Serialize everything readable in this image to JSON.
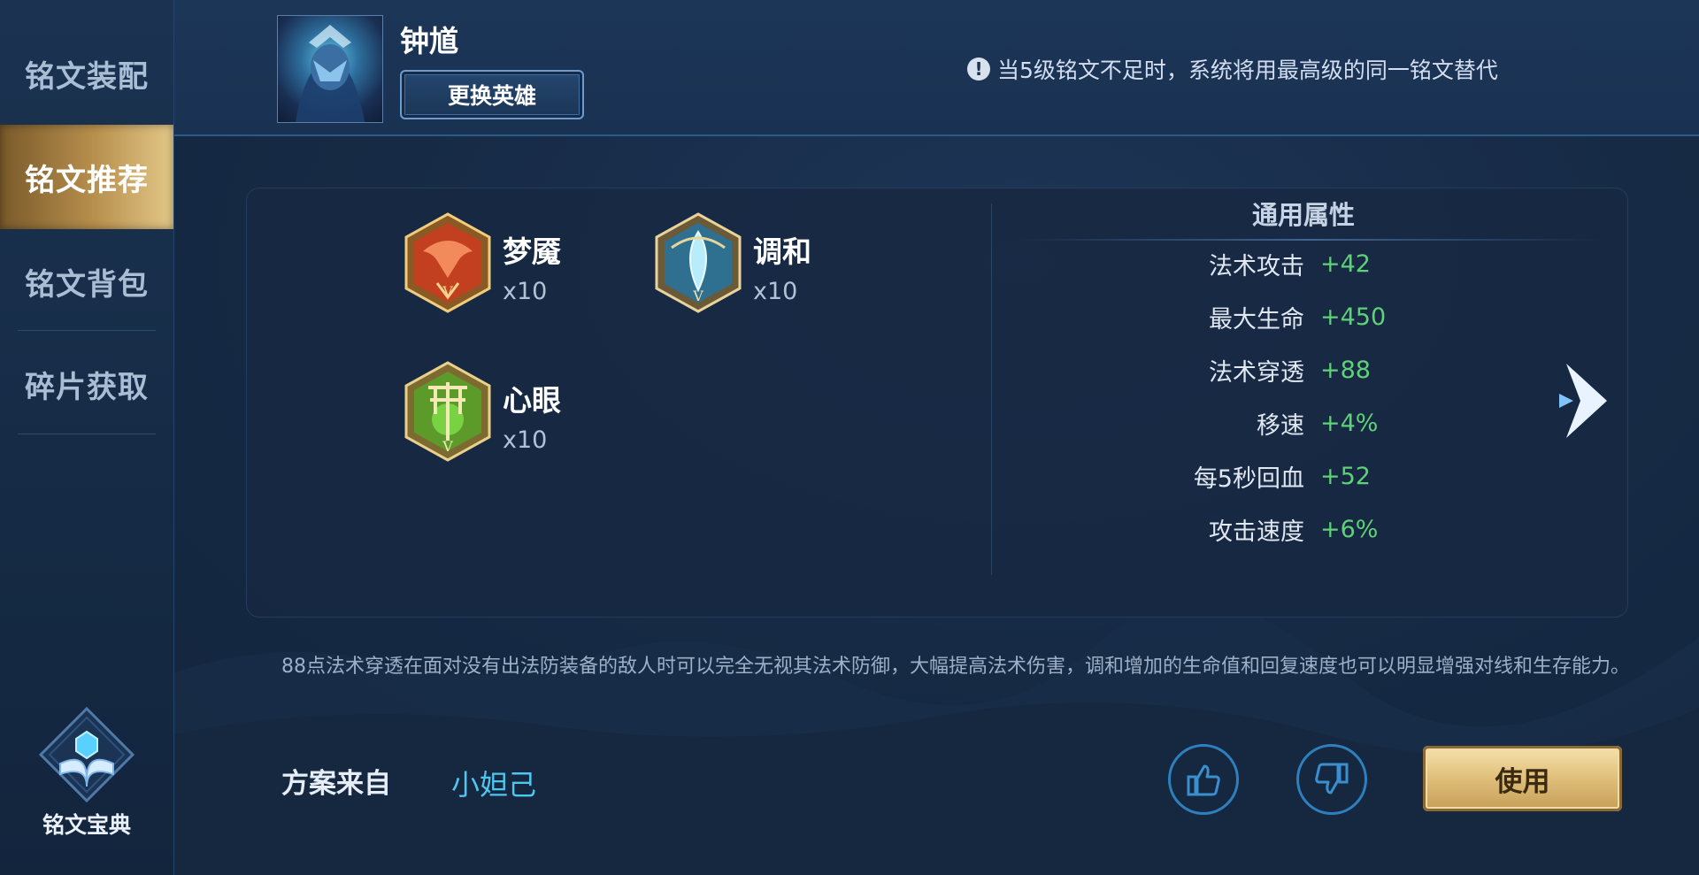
{
  "sidebar": {
    "items": [
      {
        "label": "铭文装配"
      },
      {
        "label": "铭文推荐"
      },
      {
        "label": "铭文背包"
      },
      {
        "label": "碎片获取"
      }
    ],
    "active_index": 1,
    "codex_label": "铭文宝典"
  },
  "header": {
    "hero_name": "钟馗",
    "change_hero_label": "更换英雄",
    "notice_icon": "!",
    "notice_text": "当5级铭文不足时，系统将用最高级的同一铭文替代"
  },
  "runes": [
    {
      "name": "梦魇",
      "count": "x10",
      "icon": "red-rune-icon"
    },
    {
      "name": "调和",
      "count": "x10",
      "icon": "blue-rune-icon"
    },
    {
      "name": "心眼",
      "count": "x10",
      "icon": "green-rune-icon"
    }
  ],
  "attributes": {
    "title": "通用属性",
    "rows": [
      {
        "name": "法术攻击",
        "value": "+42"
      },
      {
        "name": "最大生命",
        "value": "+450"
      },
      {
        "name": "法术穿透",
        "value": "+88"
      },
      {
        "name": "移速",
        "value": "+4%"
      },
      {
        "name": "每5秒回血",
        "value": "+52"
      },
      {
        "name": "攻击速度",
        "value": "+6%"
      }
    ]
  },
  "description": "88点法术穿透在面对没有出法防装备的敌人时可以完全无视其法术防御，大幅提高法术伤害，调和增加的生命值和回复速度也可以明显增强对线和生存能力。",
  "source": {
    "label": "方案来自",
    "author": "小妲己"
  },
  "actions": {
    "use_label": "使用"
  },
  "colors": {
    "accent_gold": "#e2c27e",
    "value_green": "#5fd178",
    "link_cyan": "#4fc6f0"
  }
}
